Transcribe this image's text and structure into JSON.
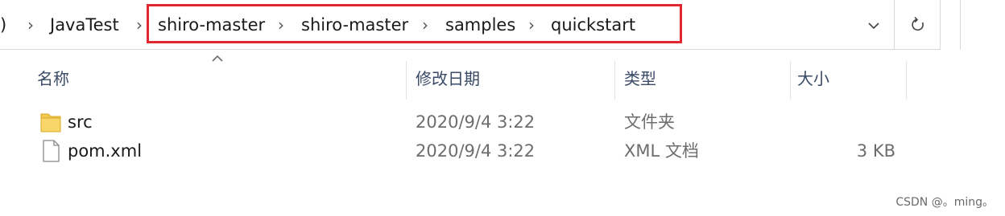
{
  "breadcrumb": {
    "truncated_left": ")",
    "items": [
      "JavaTest",
      "shiro-master",
      "shiro-master",
      "samples",
      "quickstart"
    ]
  },
  "columns": {
    "name": "名称",
    "date_modified": "修改日期",
    "type": "类型",
    "size": "大小"
  },
  "files": [
    {
      "name": "src",
      "date": "2020/9/4 3:22",
      "type": "文件夹",
      "size": "",
      "icon": "folder-icon"
    },
    {
      "name": "pom.xml",
      "date": "2020/9/4 3:22",
      "type": "XML 文档",
      "size": "3 KB",
      "icon": "document-icon"
    }
  ],
  "watermark": "CSDN @。ming。",
  "colors": {
    "highlight": "#e0262f",
    "folder": "#f3c94f",
    "header_text": "#3a4a66"
  }
}
